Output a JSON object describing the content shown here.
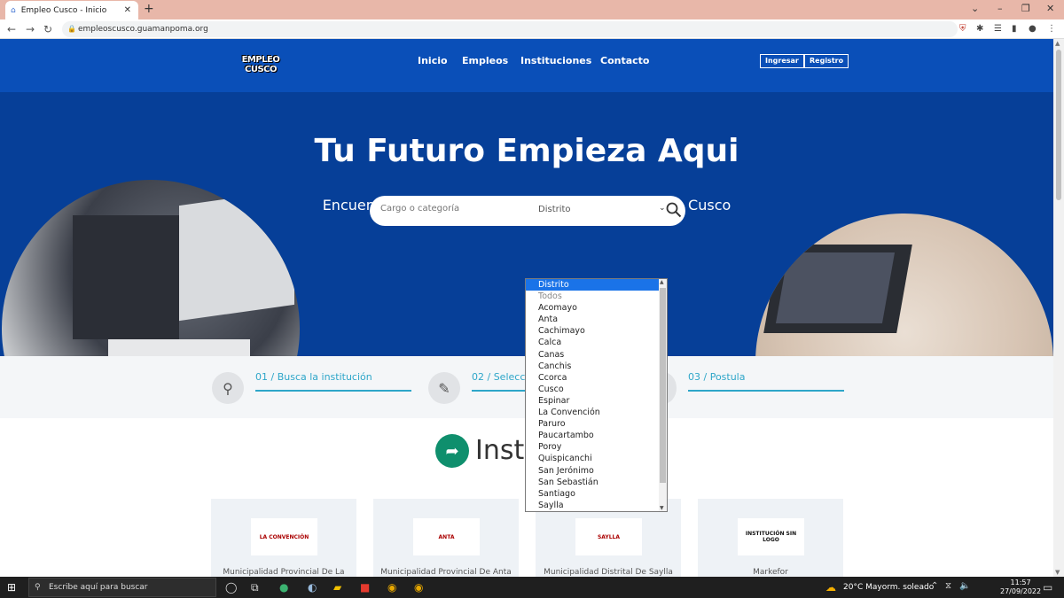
{
  "browser": {
    "tab_title": "Empleo Cusco - Inicio",
    "tab_close": "✕",
    "new_tab": "+",
    "url": "empleoscusco.guamanpoma.org",
    "window_controls": [
      "⌄",
      "–",
      "❐",
      "✕"
    ]
  },
  "header": {
    "logo_text_1": "EMPLEO",
    "logo_text_2": "CUSCO",
    "nav": [
      "Inicio",
      "Empleos",
      "Instituciones",
      "Contacto"
    ],
    "login_label": "Ingresar",
    "register_label": "Registro"
  },
  "hero": {
    "title": "Tu Futuro Empieza Aqui",
    "subtitle": "Encuentre su próximo empleo o carrera en Empleo Cusco"
  },
  "search": {
    "placeholder": "Cargo o categoría",
    "district_label": "Distrito"
  },
  "dropdown": {
    "options": [
      "Distrito",
      "Todos",
      "Acomayo",
      "Anta",
      "Cachimayo",
      "Calca",
      "Canas",
      "Canchis",
      "Ccorca",
      "Cusco",
      "Espinar",
      "La Convención",
      "Paruro",
      "Paucartambo",
      "Poroy",
      "Quispicanchi",
      "San Jerónimo",
      "San Sebastián",
      "Santiago",
      "Saylla"
    ],
    "selected_index": 0
  },
  "steps": [
    "01 / Busca la institución",
    "02 / Selecci",
    "03 / Postula"
  ],
  "institutions": {
    "title": "Instit",
    "cards": [
      {
        "name": "Municipalidad Provincial De La",
        "logo_text": "LA CONVENCIÓN"
      },
      {
        "name": "Municipalidad Provincial De Anta",
        "logo_text": "ANTA"
      },
      {
        "name": "Municipalidad Distrital De Saylla",
        "logo_text": "SAYLLA"
      },
      {
        "name": "Markefor",
        "logo_text": "INSTITUCIÓN SIN LOGO"
      }
    ]
  },
  "taskbar": {
    "search_placeholder": "Escribe aquí para buscar",
    "weather": "20°C  Mayorm. soleado",
    "time": "11:57",
    "date": "27/09/2022"
  },
  "colors": {
    "header_bg": "#0a4fb8",
    "hero_bg": "#063f98",
    "accent": "#2ea6c9",
    "inst_icon": "#0f8f6d"
  }
}
